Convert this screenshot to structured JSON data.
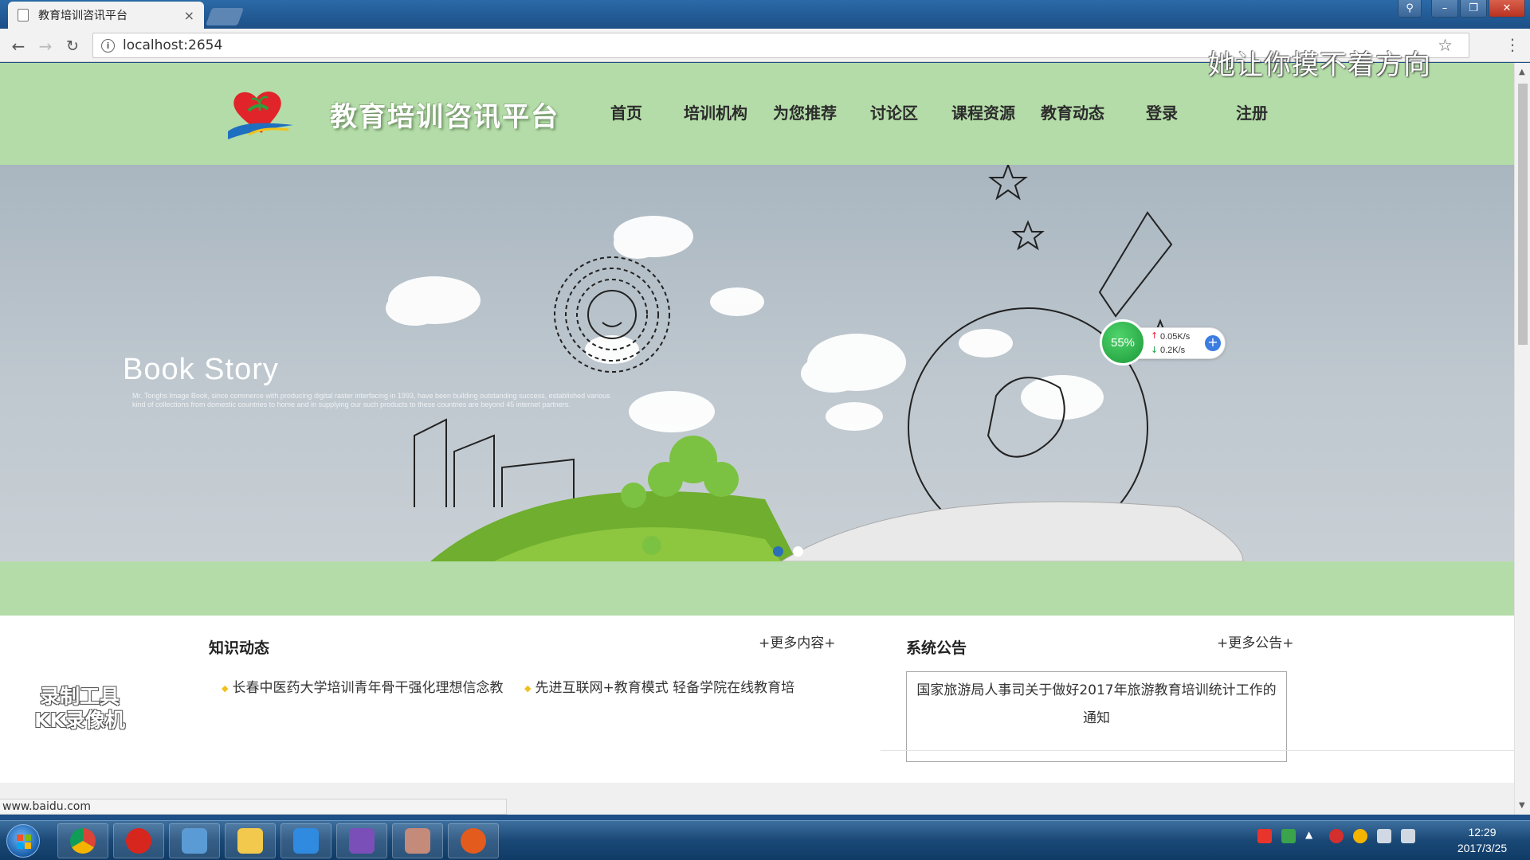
{
  "browser": {
    "tab_title": "教育培训咨讯平台",
    "tab_close": "×",
    "url": "localhost:2654",
    "status_url": "www.baidu.com"
  },
  "site": {
    "title": "教育培训咨讯平台",
    "nav": [
      "首页",
      "培训机构",
      "为您推荐",
      "讨论区",
      "课程资源",
      "教育动态",
      "登录",
      "注册"
    ]
  },
  "banner": {
    "title": "Book Story",
    "subtitle": "Mr. Tonghs Image Book, since commerce with producing digital raster interfacing in 1993, have been building outstanding success, established various kind of collections from domestic countries to home and in supplying our such products to these countries are beyond 45 internet partners.",
    "slide_count": 2,
    "active_slide": 1
  },
  "speed_widget": {
    "percent": "55%",
    "upload": "0.05K/s",
    "download": "0.2K/s"
  },
  "knowledge": {
    "title": "知识动态",
    "more": "+更多内容+",
    "items": [
      "长春中医药大学培训青年骨干强化理想信念教",
      "先进互联网+教育模式 轻备学院在线教育培"
    ]
  },
  "notice": {
    "title": "系统公告",
    "more": "+更多公告+",
    "item": "国家旅游局人事司关于做好2017年旅游教育培训统计工作的通知"
  },
  "overlays": {
    "top_right_watermark": "她让你摸不着方向",
    "recorder_watermark_line1": "录制工具",
    "recorder_watermark_line2": "KK录像机"
  },
  "taskbar": {
    "time": "12:29",
    "date": "2017/3/25"
  },
  "colors": {
    "header_green": "#b4dca8",
    "active_dot": "#2b6fb6",
    "bullet": "#f0c020"
  }
}
